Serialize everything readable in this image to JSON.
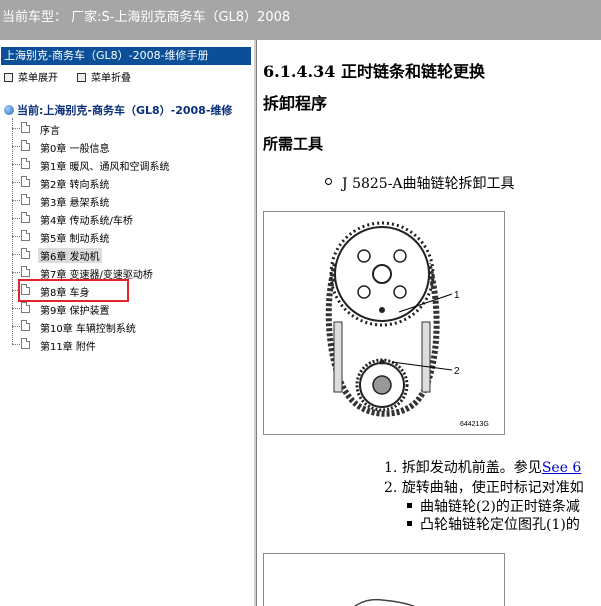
{
  "header": {
    "title": "当前车型： 厂家:S-上海别克商务车（GL8）2008"
  },
  "sidebar": {
    "book_title": "上海别克-商务车（GL8）-2008-维修手册",
    "expand_all": "菜单展开",
    "collapse_all": "菜单折叠",
    "current": "当前:上海别克-商务车（GL8）-2008-维修",
    "items": [
      {
        "label": "序言"
      },
      {
        "label": "第0章 一般信息"
      },
      {
        "label": "第1章 暖风、通风和空调系统"
      },
      {
        "label": "第2章 转向系统"
      },
      {
        "label": "第3章 悬架系统"
      },
      {
        "label": "第4章 传动系统/车桥"
      },
      {
        "label": "第5章 制动系统"
      },
      {
        "label": "第6章 发动机"
      },
      {
        "label": "第7章 变速器/变速驱动桥"
      },
      {
        "label": "第8章 车身"
      },
      {
        "label": "第9章 保护装置"
      },
      {
        "label": "第10章 车辆控制系统"
      },
      {
        "label": "第11章 附件"
      }
    ],
    "selected_index": 7,
    "highlight_color": "#e0262b"
  },
  "content": {
    "section_title": "6.1.4.34 正时链条和链轮更换",
    "subtitle": "拆卸程序",
    "tools_heading": "所需工具",
    "tool_item": "J 5825-A曲轴链轮拆卸工具",
    "figure": {
      "callout_1": "1",
      "callout_2": "2",
      "figure_id": "644213G"
    },
    "steps": [
      {
        "num": "1.",
        "text": "拆卸发动机前盖。参见",
        "link": "See 6"
      },
      {
        "num": "2.",
        "text": "旋转曲轴，使正时标记对准如"
      }
    ],
    "bullets": [
      "曲轴链轮(2)的正时链条减",
      "凸轮轴链轮定位图孔(1)的"
    ],
    "link_color": "#0000cc"
  }
}
